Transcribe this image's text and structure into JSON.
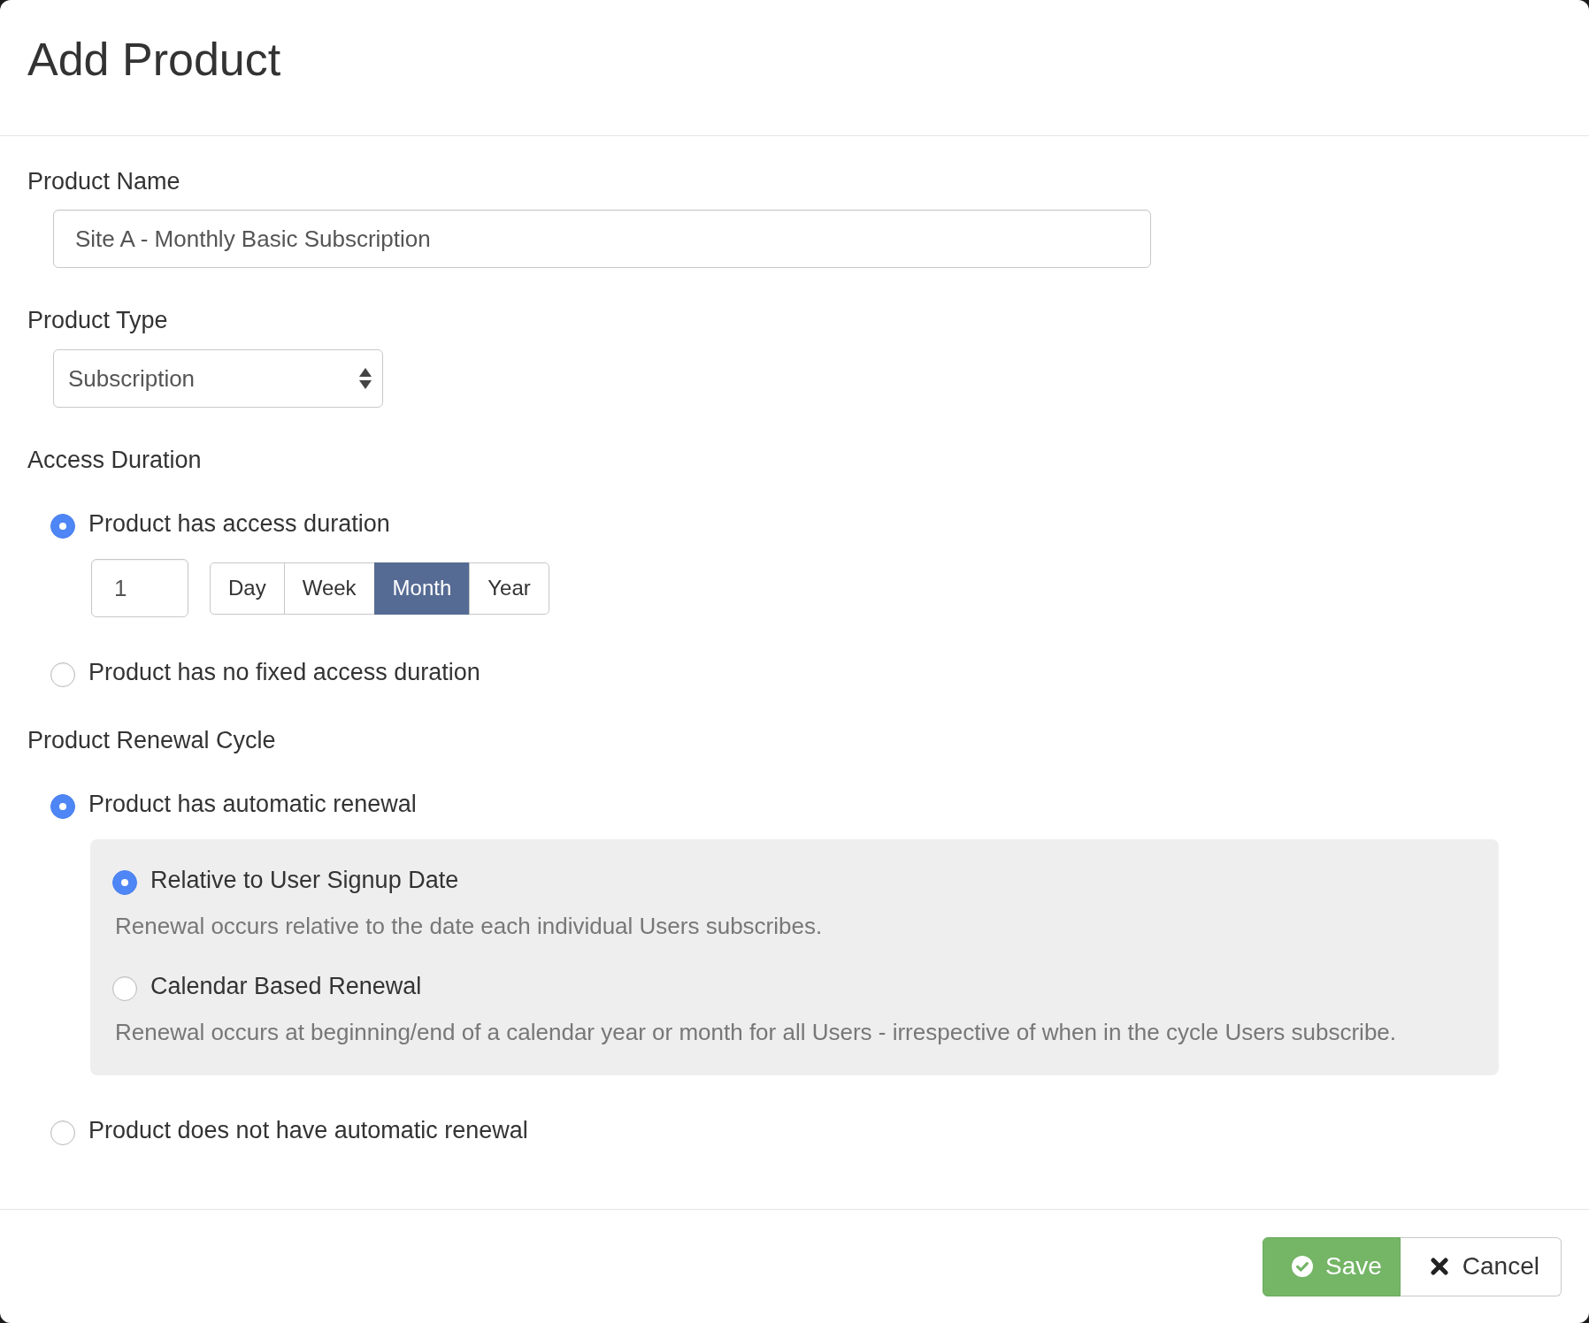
{
  "dialog": {
    "title": "Add Product"
  },
  "product_name": {
    "label": "Product Name",
    "value": "Site A - Monthly Basic Subscription"
  },
  "product_type": {
    "label": "Product Type",
    "value": "Subscription"
  },
  "access_duration": {
    "label": "Access Duration",
    "options": [
      {
        "label": "Product has access duration",
        "selected": true,
        "duration": {
          "value": "1",
          "units": [
            {
              "label": "Day",
              "selected": false
            },
            {
              "label": "Week",
              "selected": false
            },
            {
              "label": "Month",
              "selected": true
            },
            {
              "label": "Year",
              "selected": false
            }
          ]
        }
      },
      {
        "label": "Product has no fixed access duration",
        "selected": false
      }
    ]
  },
  "renewal_cycle": {
    "label": "Product Renewal Cycle",
    "options": [
      {
        "label": "Product has automatic renewal",
        "selected": true,
        "modes": [
          {
            "label": "Relative to User Signup Date",
            "selected": true,
            "description": "Renewal occurs relative to the date each individual Users subscribes."
          },
          {
            "label": "Calendar Based Renewal",
            "selected": false,
            "description": "Renewal occurs at beginning/end of a calendar year or month for all Users - irrespective of when in the cycle Users subscribe."
          }
        ]
      },
      {
        "label": "Product does not have automatic renewal",
        "selected": false
      }
    ]
  },
  "footer": {
    "buttons": [
      {
        "label": "Save",
        "kind": "primary"
      },
      {
        "label": "Cancel",
        "kind": "cancel"
      }
    ]
  }
}
